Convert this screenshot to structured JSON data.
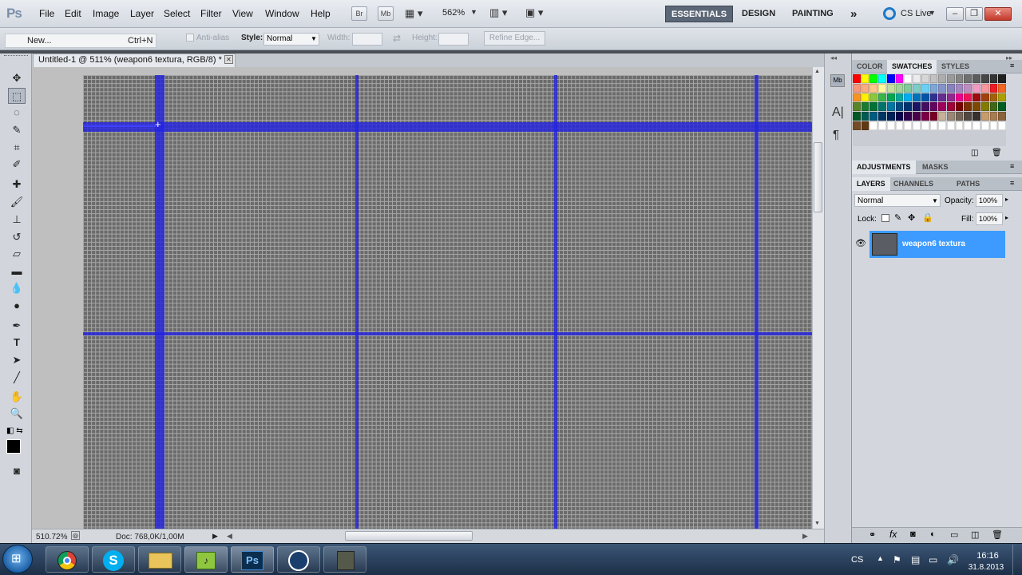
{
  "app": {
    "logo": "Ps"
  },
  "menu": [
    "File",
    "Edit",
    "Image",
    "Layer",
    "Select",
    "Filter",
    "View",
    "Window",
    "Help"
  ],
  "menubar": {
    "br_label": "Br",
    "mb_label": "Mb",
    "zoom": "562%",
    "workspaces": [
      "ESSENTIALS",
      "DESIGN",
      "PAINTING"
    ],
    "more": "»",
    "cs_live": "CS Live"
  },
  "options": {
    "tooltip_item": "New...",
    "tooltip_shortcut": "Ctrl+N",
    "antialias": "Anti-alias",
    "style_label": "Style:",
    "style_value": "Normal",
    "width_label": "Width:",
    "height_label": "Height:",
    "refine_edge": "Refine Edge..."
  },
  "document": {
    "tab_title": "Untitled-1 @ 511% (weapon6 textura, RGB/8) *",
    "zoom": "510.72%",
    "doc_info": "Doc: 768,0K/1,00M"
  },
  "panels": {
    "color_tabs": [
      "COLOR",
      "SWATCHES",
      "STYLES"
    ],
    "adj_tabs": [
      "ADJUSTMENTS",
      "MASKS"
    ],
    "layer_tabs": [
      "LAYERS",
      "CHANNELS",
      "PATHS"
    ],
    "blend_mode": "Normal",
    "opacity_label": "Opacity:",
    "opacity_value": "100%",
    "lock_label": "Lock:",
    "fill_label": "Fill:",
    "fill_value": "100%",
    "layer_name": "weapon6 textura"
  },
  "swatch_colors": [
    "#ff0000",
    "#ffff00",
    "#00ff00",
    "#00ffff",
    "#0000ff",
    "#ff00ff",
    "#ffffff",
    "#ebebeb",
    "#d6d6d6",
    "#c2c2c2",
    "#adadad",
    "#999999",
    "#858585",
    "#707070",
    "#5c5c5c",
    "#474747",
    "#333333",
    "#1f1f1f",
    "#f7977a",
    "#f9ad81",
    "#fdc68a",
    "#fff79a",
    "#c4df9b",
    "#a2d39c",
    "#82ca9d",
    "#7bcdc8",
    "#6ecff6",
    "#7ea7d8",
    "#8493ca",
    "#8882be",
    "#a187be",
    "#bc8dbf",
    "#f49ac2",
    "#f6989d",
    "#ed1c24",
    "#f26522",
    "#f7941d",
    "#fff200",
    "#8dc63f",
    "#39b54a",
    "#00a651",
    "#00a99d",
    "#00aeef",
    "#0072bc",
    "#0054a6",
    "#2e3192",
    "#662d91",
    "#92278f",
    "#ec008c",
    "#ed145b",
    "#9e0b0f",
    "#a0410d",
    "#a3620a",
    "#aba000",
    "#598527",
    "#197b30",
    "#007236",
    "#00746b",
    "#0076a3",
    "#004b80",
    "#003471",
    "#1b1464",
    "#440e62",
    "#630460",
    "#9e005d",
    "#9e0039",
    "#790000",
    "#7b2e00",
    "#7d4900",
    "#827b00",
    "#406618",
    "#005e20",
    "#005826",
    "#005952",
    "#005b7f",
    "#003663",
    "#002157",
    "#0d004c",
    "#32004b",
    "#4b0049",
    "#7b0046",
    "#7a0026",
    "#c7b299",
    "#998675",
    "#736357",
    "#534741",
    "#37302d",
    "#c69c6d",
    "#a67c52",
    "#8c6239",
    "#754c24",
    "#603913",
    "#ffffff",
    "#ffffff",
    "#ffffff",
    "#ffffff",
    "#ffffff",
    "#ffffff",
    "#ffffff",
    "#ffffff",
    "#ffffff",
    "#ffffff",
    "#ffffff",
    "#ffffff",
    "#ffffff",
    "#ffffff",
    "#ffffff",
    "#ffffff"
  ],
  "taskbar": {
    "lang": "CS",
    "time": "16:16",
    "date": "31.8.2013",
    "skype": "S",
    "ps": "Ps"
  },
  "colors": {
    "grid_line": "#2323e1",
    "selection": "#3d9bff"
  }
}
